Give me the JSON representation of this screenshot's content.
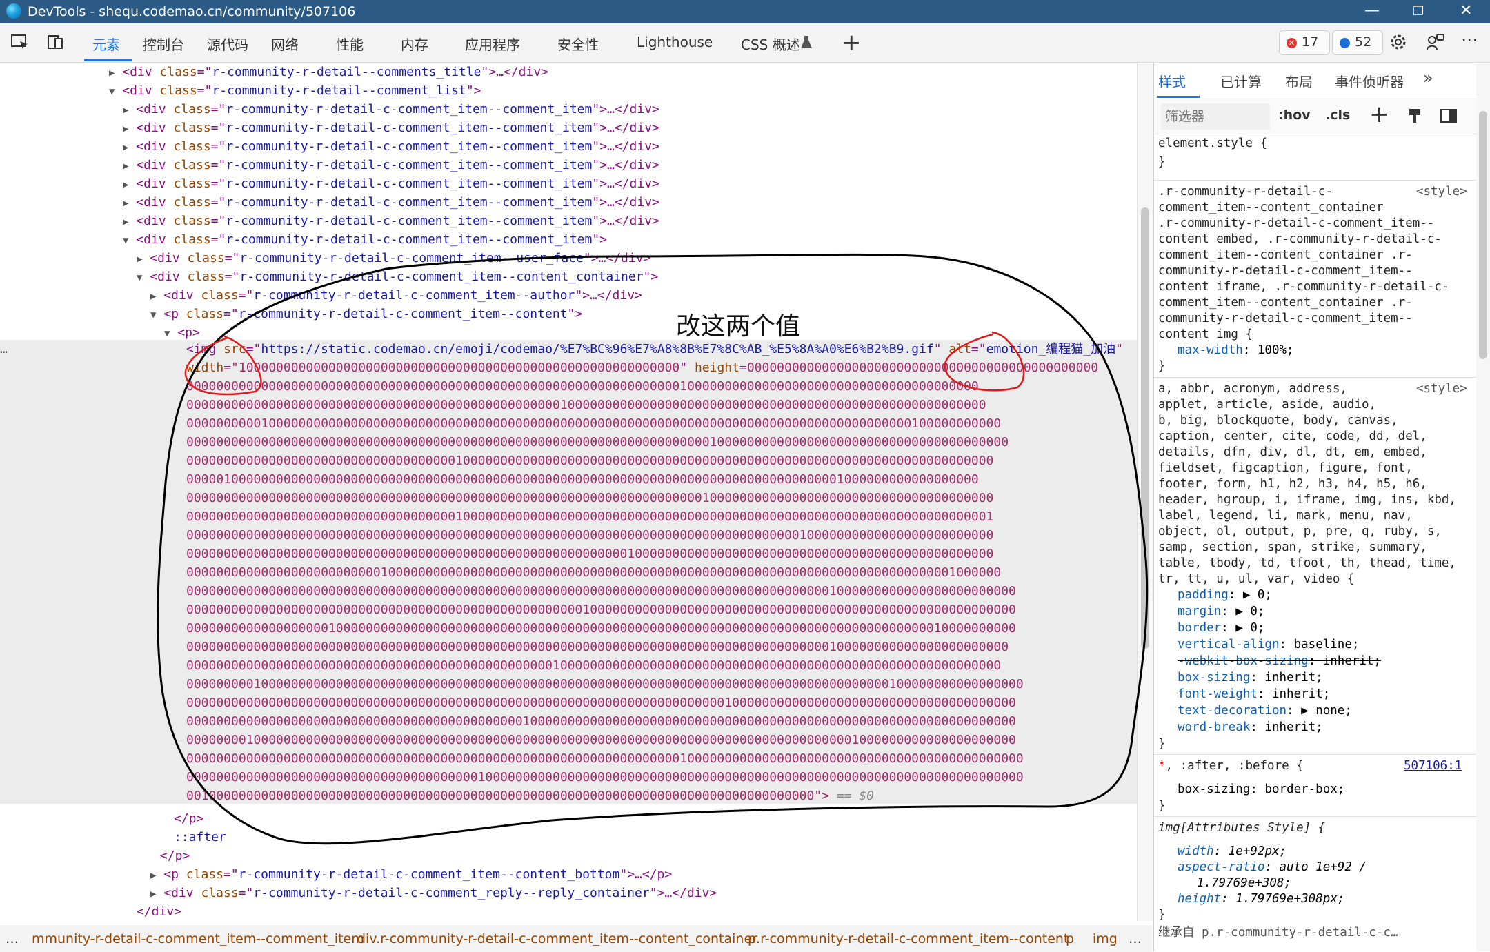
{
  "titlebar": {
    "title": "DevTools - shequ.codemao.cn/community/507106",
    "minimize": "—",
    "restore": "❐",
    "close": "✕"
  },
  "toolbar": {
    "tabs": [
      "元素",
      "控制台",
      "源代码",
      "网络",
      "性能",
      "内存",
      "应用程序",
      "安全性",
      "Lighthouse",
      "CSS 概述"
    ],
    "errors_count": "17",
    "messages_count": "52",
    "add_tab": "+",
    "more": "⋯"
  },
  "elements": {
    "lines": [
      {
        "pre": "<div ",
        "attr": "class",
        "val": "r-community-r-detail--comments_title",
        "post": ">…</div>"
      },
      {
        "pre": "<div ",
        "attr": "class",
        "val": "r-community-r-detail--comment_list",
        "post": ">"
      },
      {
        "pre": "<div ",
        "attr": "class",
        "val": "r-community-r-detail-c-comment_item--comment_item",
        "post": ">…</div>"
      },
      {
        "pre": "<div ",
        "attr": "class",
        "val": "r-community-r-detail-c-comment_item--comment_item",
        "post": ">…</div>"
      },
      {
        "pre": "<div ",
        "attr": "class",
        "val": "r-community-r-detail-c-comment_item--comment_item",
        "post": ">…</div>"
      },
      {
        "pre": "<div ",
        "attr": "class",
        "val": "r-community-r-detail-c-comment_item--comment_item",
        "post": ">…</div>"
      },
      {
        "pre": "<div ",
        "attr": "class",
        "val": "r-community-r-detail-c-comment_item--comment_item",
        "post": ">…</div>"
      },
      {
        "pre": "<div ",
        "attr": "class",
        "val": "r-community-r-detail-c-comment_item--comment_item",
        "post": ">…</div>"
      },
      {
        "pre": "<div ",
        "attr": "class",
        "val": "r-community-r-detail-c-comment_item--comment_item",
        "post": ">…</div>"
      },
      {
        "pre": "<div ",
        "attr": "class",
        "val": "r-community-r-detail-c-comment_item--comment_item",
        "post": ">"
      },
      {
        "pre": "<div ",
        "attr": "class",
        "val": "r-community-r-detail-c-comment_item--user_face",
        "post": ">…</div>"
      },
      {
        "pre": "<div ",
        "attr": "class",
        "val": "r-community-r-detail-c-comment_item--content_container",
        "post": ">"
      },
      {
        "pre": "<div ",
        "attr": "class",
        "val": "r-community-r-detail-c-comment_item--author",
        "post": ">…</div>"
      },
      {
        "pre": "<p ",
        "attr": "class",
        "val": "r-community-r-detail-c-comment_item--content",
        "post": ">"
      },
      {
        "pre": "<p>",
        "attr": "",
        "val": "",
        "post": ""
      }
    ],
    "img_line": {
      "src_attr": "src",
      "src_val": "https://static.codemao.cn/emoji/codemao/%E7%BC%96%E7%A8%8B%E7%8C%AB_%E5%8A%A0%E6%B2%B9.gif",
      "alt_attr": "alt",
      "alt_val": "emotion_编程猫_加油",
      "width_attr": "width",
      "height_attr": "height"
    },
    "zero_rows": [
      "\"1000000000000000000000000000000000000000000000000000000000000000000000000000000000000000000000000000000000",
      "0000000000000000000000000000000000000000000000000000000000000000001000000000000000000000000000000000000000",
      "00000000000000000000000000000000000000000000000000100000000000000000000000000000000000000000000000000000000",
      "0000000000100000000000000000000000000000000000000000000000000000000000000000000000000000000000000100000000000",
      "00000000000000000000000000000000000000000000000000000000000000000000001000000000000000000000000000000000000000",
      "000000000000000000000000000000000000100000000000000000000000000000000000000000000000000000000000000000000000",
      "0000010000000000000000000000000000000000000000000000000000000000000000000000000000000001000000000000000000",
      "000000000000000000000000000000000000000000000000000000000000000000000100000000000000000000000000000000000000",
      "000000000000000000000000000000000000100000000000000000000000000000000000000000000000000000000000000000000001",
      "000000000000000000000000000000000000000000000000000000000000000000000000000000000010000000000000000000000000",
      "000000000000000000000000000000000000000000000000000000000001000000000000000000000000000000000000000000000000",
      "0000000000000000000000000010000000000000000000000000000000000000000000000000000000000000000000000000001000000",
      "000000000000000000000000000000000000000000000000000000000000000000000000000000000000001000000000000000000000000",
      "000000000000000000000000000000000000000000000000000001000000000000000000000000000000000000000000000000000000000",
      "000000000000000000010000000000000000000000000000000000000000000000000000000000000000000000000000000010000000000",
      "00000000000000000000000000000000000000000000000000000000000000000000000000000000000000100000000000000000000000",
      "0000000000000000000000000000000000000000000000000100000000000000000000000000000000000000000000000000000000000",
      "0000000001000000000000000000000000000000000000000000000000000000000000000000000000000000000000100000000000000000",
      "000000000000000000000000000000000000000000000000000000000000000000000000100000000000000000000000000000000000000",
      "000000000000000000000000000000000000000000000100000000000000000000000000000000000000000000000000000000000000000",
      "000000001000000000000000000000000000000000000000000000000000000000000000000000000000000001000000000000000000000",
      "0000000000000000000000000000000000000000000000000000000000000000001000000000000000000000000000000000000000000000",
      "0000000000000000000000000000000000000001000000000000000000000000000000000000000000000000000000000000000000000000",
      "001000000000000000000000000000000000000000000000000000000000000000000000000000000000\">"
    ],
    "eq0": "== $0",
    "tail": [
      {
        "indent": "</p>"
      },
      {
        "indent": "::after"
      },
      {
        "indent": "</p>"
      },
      {
        "pre": "<p ",
        "attr": "class",
        "val": "r-community-r-detail-c-comment_item--content_bottom",
        "post": ">…</p>"
      },
      {
        "pre": "<div ",
        "attr": "class",
        "val": "r-community-r-detail-c-comment_reply--reply_container",
        "post": ">…</div>"
      },
      {
        "indent": "</div>"
      },
      {
        "indent": "</div>"
      }
    ],
    "gutter_dots": "…"
  },
  "breadcrumb": [
    "…",
    "mmunity-r-detail-c-comment_item--comment_item",
    "div.r-community-r-detail-c-comment_item--content_container",
    "p.r-community-r-detail-c-comment_item--content",
    "p",
    "img",
    "…"
  ],
  "styles": {
    "tabs": [
      "样式",
      "已计算",
      "布局",
      "事件侦听器",
      "»"
    ],
    "filter_placeholder": "筛选器",
    "hov": ":hov",
    "cls": ".cls",
    "element_style": "element.style {",
    "close_brace": "}",
    "rule1_selector": [
      ".r-community-r-detail-c-",
      "comment_item--content_container",
      ".r-community-r-detail-c-comment_item--",
      "content embed, .r-community-r-detail-c-",
      "comment_item--content_container .r-",
      "community-r-detail-c-comment_item--",
      "content iframe, .r-community-r-detail-c-",
      "comment_item--content_container .r-",
      "community-r-detail-c-comment_item--",
      "content img {"
    ],
    "rule1_source": "<style>",
    "rule1_prop": "max-width",
    "rule1_val": "100%;",
    "rule2_selector": [
      "a, abbr, acronym, address,",
      "applet, article, aside, audio,",
      "b, big, blockquote, body, canvas,",
      "caption, center, cite, code, dd, del,",
      "details, dfn, div, dl, dt, em, embed,",
      "fieldset, figcaption, figure, font,",
      "footer, form, h1, h2, h3, h4, h5, h6,",
      "header, hgroup, i, iframe, img, ins, kbd,",
      "label, legend, li, mark, menu, nav,",
      "object, ol, output, p, pre, q, ruby, s,",
      "samp, section, span, strike, summary,",
      "table, tbody, td, tfoot, th, thead, time,",
      "tr, tt, u, ul, var, video {"
    ],
    "rule2_source": "<style>",
    "rule2_props": [
      {
        "name": "padding",
        "val": "▶ 0;",
        "strike": false
      },
      {
        "name": "margin",
        "val": "▶ 0;",
        "strike": false
      },
      {
        "name": "border",
        "val": "▶ 0;",
        "strike": false
      },
      {
        "name": "vertical-align",
        "val": "baseline;",
        "strike": false
      },
      {
        "name": "-webkit-box-sizing",
        "val": "inherit;",
        "strike": true
      },
      {
        "name": "box-sizing",
        "val": "inherit;",
        "strike": false
      },
      {
        "name": "font-weight",
        "val": "inherit;",
        "strike": false
      },
      {
        "name": "text-decoration",
        "val": "▶ none;",
        "strike": false
      },
      {
        "name": "word-break",
        "val": "inherit;",
        "strike": false
      }
    ],
    "rule3_selector": "*, :after, :before {",
    "rule3_source": "507106:1",
    "rule3_prop": "box-sizing: border-box;",
    "rule4_selector": "img[Attributes Style] {",
    "rule4_props": [
      {
        "name": "width",
        "val": "1e+92px;"
      },
      {
        "name": "aspect-ratio",
        "val": "auto 1e+92 /"
      },
      {
        "name": "",
        "val": "1.79769e+308;"
      },
      {
        "name": "height",
        "val": "1.79769e+308px;"
      }
    ],
    "inherit_label": "继承自 p.r-community-r-detail-c-c…"
  },
  "annotation": {
    "text": "改这两个值"
  },
  "colors": {
    "accent": "#1a73e8",
    "titlebar": "#2b5b84",
    "tag": "#881280",
    "attr": "#994500",
    "value": "#1a1aa6",
    "zeros": "#a12d6b",
    "error": "#e53935",
    "info": "#1e6fd9"
  }
}
